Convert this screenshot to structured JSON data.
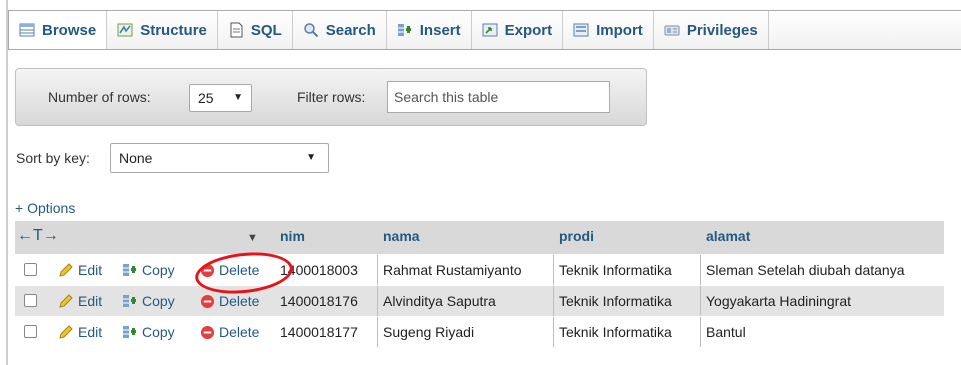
{
  "tabs": [
    {
      "label": "Browse",
      "icon": "table-icon",
      "active": true
    },
    {
      "label": "Structure",
      "icon": "structure-icon"
    },
    {
      "label": "SQL",
      "icon": "sql-icon"
    },
    {
      "label": "Search",
      "icon": "search-icon"
    },
    {
      "label": "Insert",
      "icon": "insert-icon"
    },
    {
      "label": "Export",
      "icon": "export-icon"
    },
    {
      "label": "Import",
      "icon": "import-icon"
    },
    {
      "label": "Privileges",
      "icon": "privileges-icon"
    }
  ],
  "nav": {
    "rows_label": "Number of rows:",
    "rows_value": "25",
    "filter_label": "Filter rows:",
    "filter_placeholder": "Search this table"
  },
  "sort": {
    "label": "Sort by key:",
    "value": "None"
  },
  "options_link": "+ Options",
  "table": {
    "columns": [
      "nim",
      "nama",
      "prodi",
      "alamat"
    ],
    "actions": {
      "edit": "Edit",
      "copy": "Copy",
      "delete": "Delete"
    },
    "rows": [
      {
        "nim": "1400018003",
        "nama": "Rahmat Rustamiyanto",
        "prodi": "Teknik Informatika",
        "alamat": "Sleman Setelah diubah datanya"
      },
      {
        "nim": "1400018176",
        "nama": "Alvinditya Saputra",
        "prodi": "Teknik Informatika",
        "alamat": "Yogyakarta Hadiningrat"
      },
      {
        "nim": "1400018177",
        "nama": "Sugeng Riyadi",
        "prodi": "Teknik Informatika",
        "alamat": "Bantul"
      }
    ]
  },
  "colors": {
    "link": "#235a81",
    "highlight_ring": "#e8131a",
    "delete_icon": "#e04040"
  }
}
